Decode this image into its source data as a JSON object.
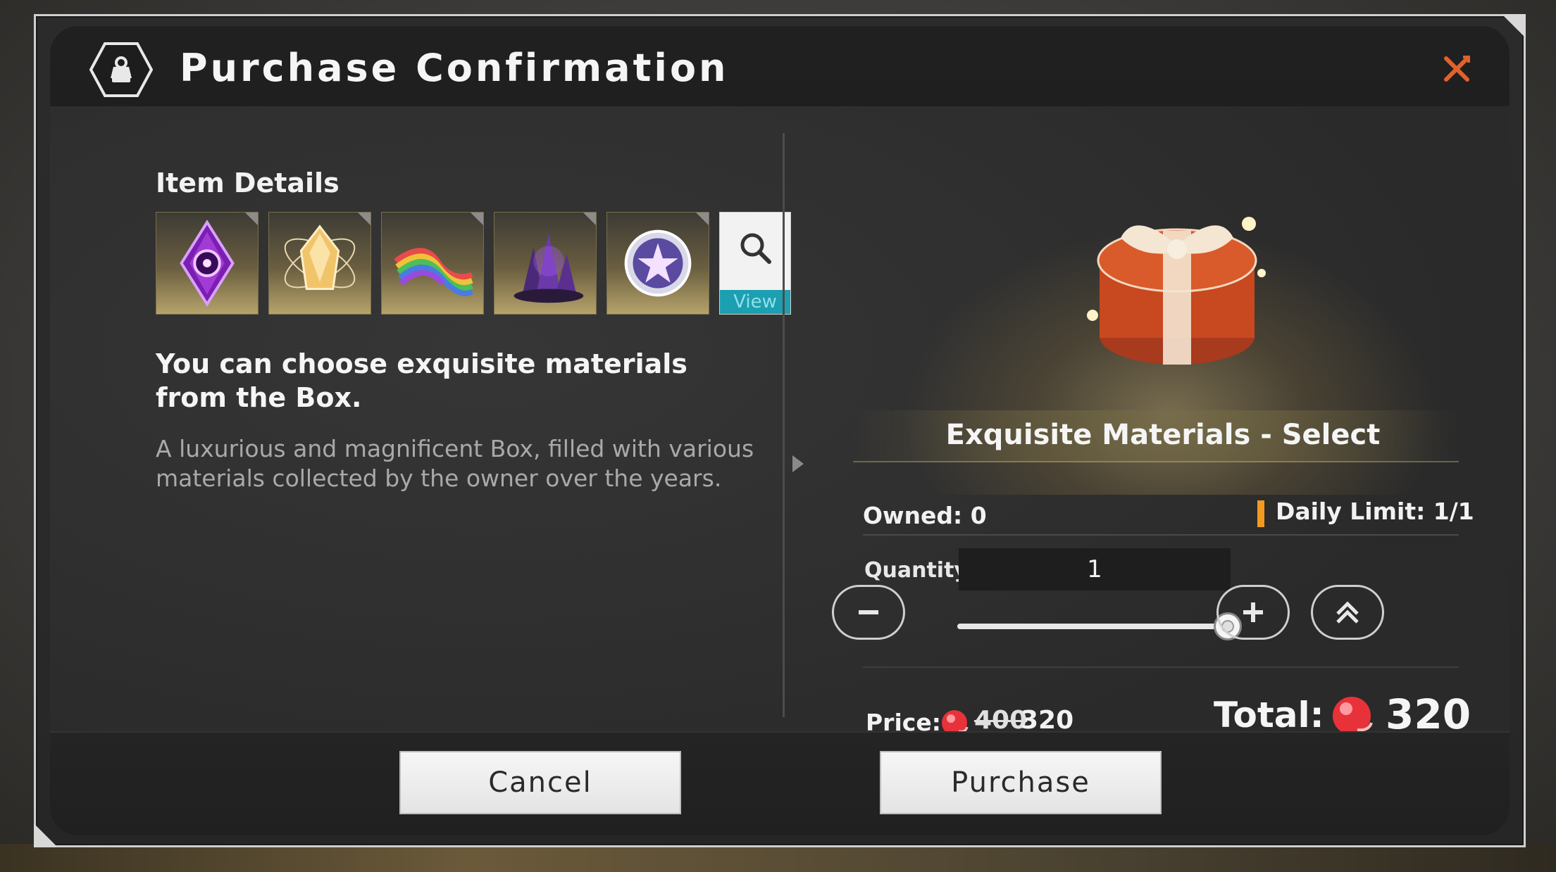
{
  "dialog": {
    "title": "Purchase Confirmation",
    "header_icon": "shop-bag-icon",
    "close_icon": "close-icon"
  },
  "details": {
    "label": "Item Details",
    "items": [
      {
        "icon": "purple-eye-gem-icon"
      },
      {
        "icon": "amber-crystal-icon"
      },
      {
        "icon": "rainbow-ribbon-icon"
      },
      {
        "icon": "dark-crystal-cluster-icon"
      },
      {
        "icon": "star-orb-icon"
      }
    ],
    "view_label": "View",
    "description": "You can choose exquisite materials from the Box.",
    "flavor": "A luxurious and magnificent Box, filled with various materials collected by the owner over the years."
  },
  "product": {
    "name": "Exquisite Materials - Select",
    "image_icon": "gift-box-icon",
    "owned": "Owned: 0",
    "daily_limit": "Daily Limit: 1/1",
    "quantity_label": "Quantity",
    "quantity": "1",
    "quantity_fraction": 1.0,
    "price_label": "Price:",
    "price_original": "400",
    "price_current": "320",
    "total_label": "Total:",
    "total_value": "320",
    "currency_icon": "red-gem-icon"
  },
  "buttons": {
    "cancel": "Cancel",
    "purchase": "Purchase"
  },
  "colors": {
    "accent_orange": "#f29a1f",
    "view_teal": "#1c9fb0",
    "close_orange": "#e0622a"
  }
}
